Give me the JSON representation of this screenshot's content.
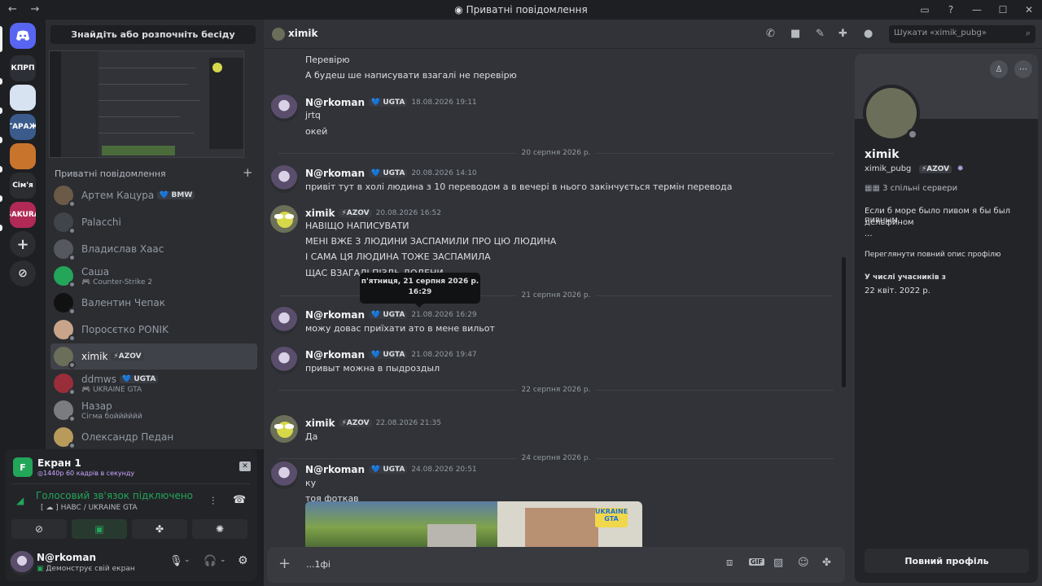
{
  "titlebar": {
    "title": "Приватні повідомлення",
    "back": "←",
    "forward": "→"
  },
  "guilds": [
    {
      "label": "КПРП",
      "color": "#2d2f36"
    },
    {
      "label": "",
      "color": "#d7e3f0"
    },
    {
      "label": "ГАРАЖ",
      "color": "#3a5b8c"
    },
    {
      "label": "",
      "color": "#c9742c"
    },
    {
      "label": "Сім'я",
      "color": "#2b2d31"
    },
    {
      "label": "SAKURA",
      "color": "#b02a55"
    }
  ],
  "dms": {
    "find_label": "Знайдіть або розпочніть бесіду",
    "header": "Приватні повідомлення",
    "items": [
      {
        "name": "Артем Кацура",
        "tag": "💙 BMW",
        "sub": "",
        "color": "#6b5a48"
      },
      {
        "name": "Palacchi",
        "tag": "",
        "sub": "",
        "color": "#40444b"
      },
      {
        "name": "Владислав Хаас",
        "tag": "",
        "sub": "",
        "color": "#55585f"
      },
      {
        "name": "Саша",
        "tag": "",
        "sub": "🎮 Counter-Strike 2",
        "color": "#23a55a"
      },
      {
        "name": "Валентин Чепак",
        "tag": "",
        "sub": "",
        "color": "#111"
      },
      {
        "name": "Поросєтко PONIK",
        "tag": "",
        "sub": "",
        "color": "#c8a48a"
      },
      {
        "name": "ximik",
        "tag": "⚡AZOV",
        "sub": "",
        "color": "#6b6e58"
      },
      {
        "name": "ddmws",
        "tag": "💙 UGTA",
        "sub": "🎮 UKRAINE GTA",
        "color": "#9a2d3a"
      },
      {
        "name": "Назар",
        "tag": "",
        "sub": "Сігма бойййййй",
        "color": "#7a7c80"
      },
      {
        "name": "Олександр Педан",
        "tag": "",
        "sub": "",
        "color": "#b89a5a"
      }
    ]
  },
  "panel": {
    "screen_title": "Екран 1",
    "screen_icon": "F",
    "screen_sub": "1440р 60 кадрів в секунду",
    "voice_status": "Голосовий зв'язок підключено",
    "voice_channel": "[ ☁ ] HABC / UKRAINE GTA",
    "user_name": "N@rkoman",
    "user_status": "Демонструє свій екран"
  },
  "chat": {
    "header_name": "ximik",
    "search_placeholder": "Шукати «ximik_pubg»",
    "input_value": "...1фі",
    "tooltip_line1": "п'ятниця, 21 серпня 2026 р.",
    "tooltip_line2": "16:29",
    "msgs": [
      {
        "text": "Перевірю"
      },
      {
        "text": "А будеш ше написувати взагалі не перевірю"
      },
      {
        "author": "N@rkoman",
        "tag": "💙 UGTA",
        "ts": "18.08.2026 19:11"
      },
      {
        "text": "jrtq"
      },
      {
        "text": "окей"
      },
      {
        "divider": "20 серпня 2026 р."
      },
      {
        "author": "N@rkoman",
        "tag": "💙 UGTA",
        "ts": "20.08.2026 14:10"
      },
      {
        "text": "привіт тут в холі людина з 10 переводом а в вечері в нього закінчується термін перевода"
      },
      {
        "author": "ximik",
        "tag": "⚡AZOV",
        "ts": "20.08.2026 16:52"
      },
      {
        "text": "НАВІЩО НАПИСУВАТИ"
      },
      {
        "text": "МЕНІ ВЖЕ З ЛЮДИНИ ЗАСПАМИЛИ ПРО ЦЮ ЛЮДИНА"
      },
      {
        "text": "І САМА ЦЯ ЛЮДИНА ТОЖЕ ЗАСПАМИЛА"
      },
      {
        "text": "ЩАС ВЗАГАЛІ ПІЗДЬ ДОДЕНИ"
      },
      {
        "divider": "21 серпня 2026 р."
      },
      {
        "author": "N@rkoman",
        "tag": "💙 UGTA",
        "ts": "21.08.2026 16:29"
      },
      {
        "text": "можу довас приїхати ато в мене вильот"
      },
      {
        "author": "N@rkoman",
        "tag": "💙 UGTA",
        "ts": "21.08.2026 19:47"
      },
      {
        "text": "привыт можна в пыдроздыл"
      },
      {
        "divider": "22 серпня 2026 р."
      },
      {
        "author": "ximik",
        "tag": "⚡AZOV",
        "ts": "22.08.2026 21:35"
      },
      {
        "text": "Да"
      },
      {
        "divider": "24 серпня 2026 р."
      },
      {
        "author": "N@rkoman",
        "tag": "💙 UGTA",
        "ts": "24.08.2026 20:51"
      },
      {
        "text": "ку"
      },
      {
        "text": "тоя фоткав"
      }
    ]
  },
  "profile": {
    "display_name": "ximik",
    "username": "ximik_pubg",
    "tag": "⚡AZOV",
    "mutual": "3 спільні сервери",
    "bio1": "Если б море было пивом я бы был пивным",
    "bio2": "дельфином",
    "bio3": "...",
    "view_full": "Переглянути повний опис профілю",
    "member_since_label": "У числі учасників з",
    "member_since": "22 квіт. 2022 р.",
    "full_profile": "Повний профіль"
  },
  "image_sign": "UKRAINE GTA"
}
